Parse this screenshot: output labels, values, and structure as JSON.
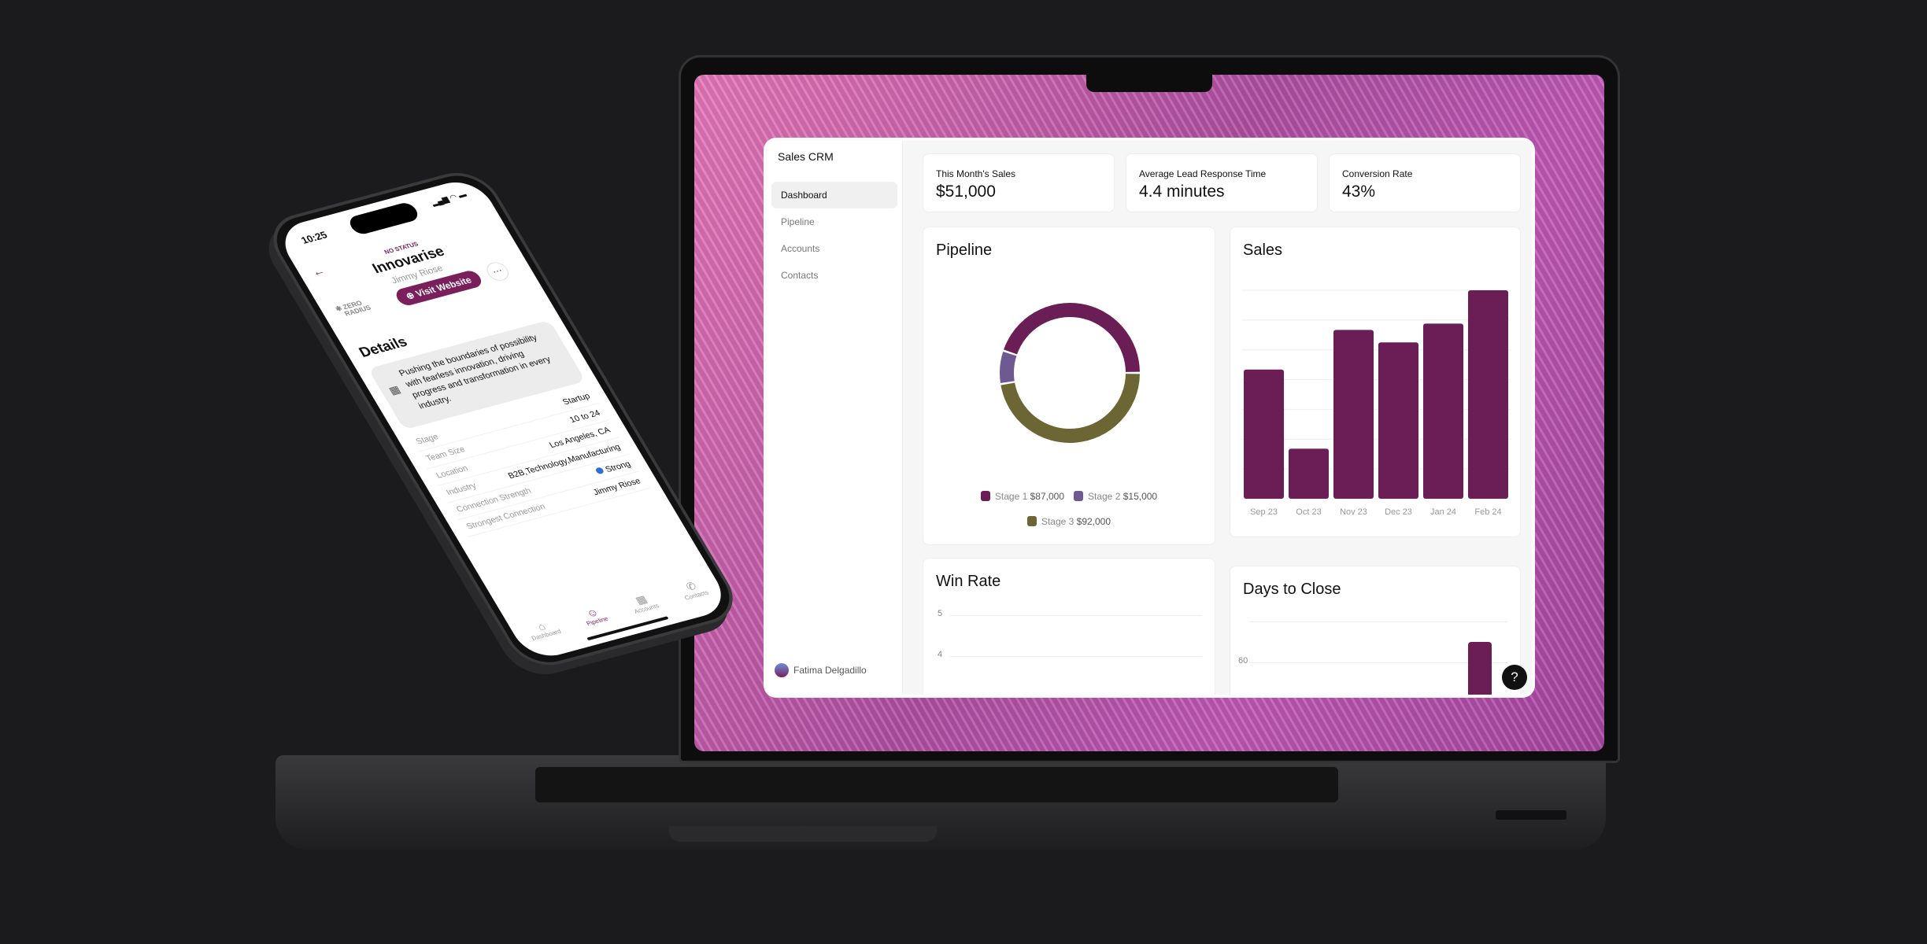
{
  "dashboard": {
    "app_title": "Sales CRM",
    "nav": [
      {
        "label": "Dashboard",
        "active": true
      },
      {
        "label": "Pipeline"
      },
      {
        "label": "Accounts"
      },
      {
        "label": "Contacts"
      }
    ],
    "user": "Fatima Delgadillo",
    "kpis": [
      {
        "label": "This Month's Sales",
        "value": "$51,000"
      },
      {
        "label": "Average Lead Response Time",
        "value": "4.4 minutes"
      },
      {
        "label": "Conversion Rate",
        "value": "43%"
      }
    ],
    "pipeline": {
      "title": "Pipeline"
    },
    "sales": {
      "title": "Sales"
    },
    "win_rate": {
      "title": "Win Rate",
      "ticks": [
        "5",
        "4"
      ]
    },
    "days_to_close": {
      "title": "Days to Close",
      "ticks": [
        "60"
      ]
    },
    "help_label": "?"
  },
  "chart_data": [
    {
      "type": "pie",
      "title": "Pipeline",
      "donut": true,
      "slices": [
        {
          "name": "Stage 1",
          "label": "$87,000",
          "value": 87000,
          "color": "#6b1d55"
        },
        {
          "name": "Stage 2",
          "label": "$15,000",
          "value": 15000,
          "color": "#6e5a91"
        },
        {
          "name": "Stage 3",
          "label": "$92,000",
          "value": 92000,
          "color": "#6b6633"
        }
      ]
    },
    {
      "type": "bar",
      "title": "Sales",
      "categories": [
        "Sep 23",
        "Oct 23",
        "Nov 23",
        "Dec 23",
        "Jan 24",
        "Feb 24"
      ],
      "values": [
        62,
        24,
        81,
        75,
        84,
        100
      ],
      "ylim": [
        0,
        100
      ],
      "grid": true,
      "color": "#6b1d55"
    }
  ],
  "phone": {
    "time": "10:25",
    "status_icons": "signal wifi battery",
    "status": "NO STATUS",
    "company": "Innovarise",
    "contact": "Jimmy Riose",
    "logo_text": [
      "ZERO",
      "RADIUS"
    ],
    "visit_label": "Visit Website",
    "more_label": "···",
    "details_title": "Details",
    "description": "Pushing the boundaries of possibility with fearless innovation, driving progress and transformation in every industry.",
    "fields": [
      {
        "label": "Stage",
        "value": "Startup"
      },
      {
        "label": "Team Size",
        "value": "10 to 24"
      },
      {
        "label": "Location",
        "value": "Los Angeles, CA"
      },
      {
        "label": "Industry",
        "value": "B2B,Technology,Manufacturing"
      },
      {
        "label": "Connection Strength",
        "value": "Strong"
      },
      {
        "label": "Strongest Connection",
        "value": "Jimmy Riose"
      }
    ],
    "tabs": [
      {
        "label": "Dashboard",
        "icon": "home-icon"
      },
      {
        "label": "Pipeline",
        "icon": "smile-icon",
        "active": true
      },
      {
        "label": "Accounts",
        "icon": "building-icon"
      },
      {
        "label": "Contacts",
        "icon": "phone-icon"
      }
    ]
  }
}
